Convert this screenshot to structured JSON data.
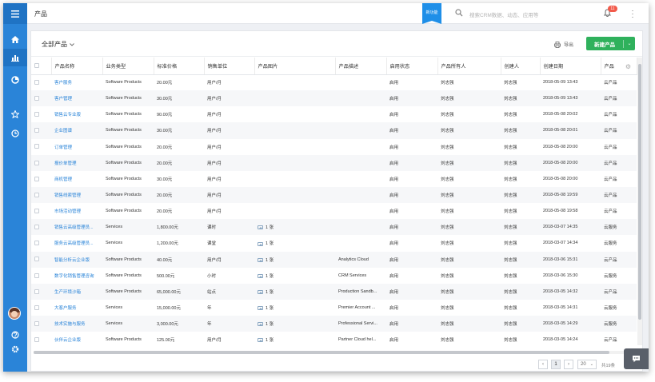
{
  "header": {
    "title": "产品",
    "new_feature_badge": "新功能",
    "search_placeholder": "搜索CRM数据、动态、应用等",
    "notification_count": "11"
  },
  "toolbar": {
    "filter_label": "全部产品",
    "export_label": "导出",
    "new_button_label": "新建产品"
  },
  "table": {
    "columns": [
      "产品名称",
      "业务类型",
      "标准价格",
      "销售单位",
      "产品图片",
      "产品描述",
      "启用状态",
      "产品所有人",
      "创建人",
      "创建日期",
      "产品"
    ],
    "rows": [
      [
        "客户服务",
        "Software Products",
        "20.00元",
        "用户/月",
        "",
        "",
        "启用",
        "刘志强",
        "刘志强",
        "2018-05-09 13:43",
        "云产品"
      ],
      [
        "客户管理",
        "Software Products",
        "30.00元",
        "用户/月",
        "",
        "",
        "启用",
        "刘志强",
        "刘志强",
        "2018-05-09 13:43",
        "云产品"
      ],
      [
        "销售云专业版",
        "Software Products",
        "90.00元",
        "用户/月",
        "",
        "",
        "启用",
        "刘志强",
        "刘志强",
        "2018-05-08 20:02",
        "云产品"
      ],
      [
        "企业图谱",
        "Software Products",
        "30.00元",
        "用户/月",
        "",
        "",
        "启用",
        "刘志强",
        "刘志强",
        "2018-05-08 20:01",
        "云产品"
      ],
      [
        "订单管理",
        "Software Products",
        "20.00元",
        "用户/月",
        "",
        "",
        "启用",
        "刘志强",
        "刘志强",
        "2018-05-08 20:00",
        "云产品"
      ],
      [
        "报价单管理",
        "Software Products",
        "20.00元",
        "用户/月",
        "",
        "",
        "启用",
        "刘志强",
        "刘志强",
        "2018-05-08 20:00",
        "云产品"
      ],
      [
        "商机管理",
        "Software Products",
        "30.00元",
        "用户/月",
        "",
        "",
        "启用",
        "刘志强",
        "刘志强",
        "2018-05-08 20:00",
        "云产品"
      ],
      [
        "销售线索管理",
        "Software Products",
        "20.00元",
        "用户/月",
        "",
        "",
        "启用",
        "刘志强",
        "刘志强",
        "2018-05-08 19:59",
        "云产品"
      ],
      [
        "市场活动管理",
        "Software Products",
        "20.00元",
        "用户/月",
        "",
        "",
        "启用",
        "刘志强",
        "刘志强",
        "2018-05-08 19:58",
        "云产品"
      ],
      [
        "销售云高级管理员...",
        "Services",
        "1,800.00元",
        "课时",
        "1 张",
        "",
        "启用",
        "刘志强",
        "刘志强",
        "2018-03-07 14:35",
        "云服务"
      ],
      [
        "服务云高级管理员...",
        "Services",
        "1,200.00元",
        "课堂",
        "1 张",
        "",
        "启用",
        "刘志强",
        "刘志强",
        "2018-03-07 14:34",
        "云服务"
      ],
      [
        "智能分析云企业版",
        "Software Products",
        "40.00元",
        "用户/月",
        "1 张",
        "Analytics Cloud",
        "启用",
        "刘志强",
        "刘志强",
        "2018-03-06 15:31",
        "云产品"
      ],
      [
        "数字化销售管理咨询",
        "Software Products",
        "500.00元",
        "小时",
        "1 张",
        "CRM Services",
        "启用",
        "刘志强",
        "刘志强",
        "2018-03-06 15:30",
        "云服务"
      ],
      [
        "生产环境沙箱",
        "Software Products",
        "65,000.00元",
        "站点",
        "1 张",
        "Production Sandb...",
        "启用",
        "刘志强",
        "刘志强",
        "2018-03-05 14:32",
        "云产品"
      ],
      [
        "大客户服务",
        "Services",
        "15,000.00元",
        "年",
        "1 张",
        "Premier Account ...",
        "启用",
        "刘志强",
        "刘志强",
        "2018-03-05 14:31",
        "云服务"
      ],
      [
        "技术实施与服务",
        "Services",
        "3,000.00元",
        "年",
        "1 张",
        "Professional Servi...",
        "启用",
        "刘志强",
        "刘志强",
        "2018-03-05 14:29",
        "云服务"
      ],
      [
        "伙伴云企业版",
        "Software Products",
        "125.00元",
        "用户/月",
        "1 张",
        "Partner Cloud hel...",
        "启用",
        "刘志强",
        "刘志强",
        "2018-03-05 14:24",
        "云产品"
      ]
    ]
  },
  "pagination": {
    "prev": "‹",
    "current": "1",
    "next": "›",
    "page_size": "20",
    "total": "共19条"
  },
  "icons": {
    "accent": "#2a84d8",
    "success": "#2fb15c"
  }
}
